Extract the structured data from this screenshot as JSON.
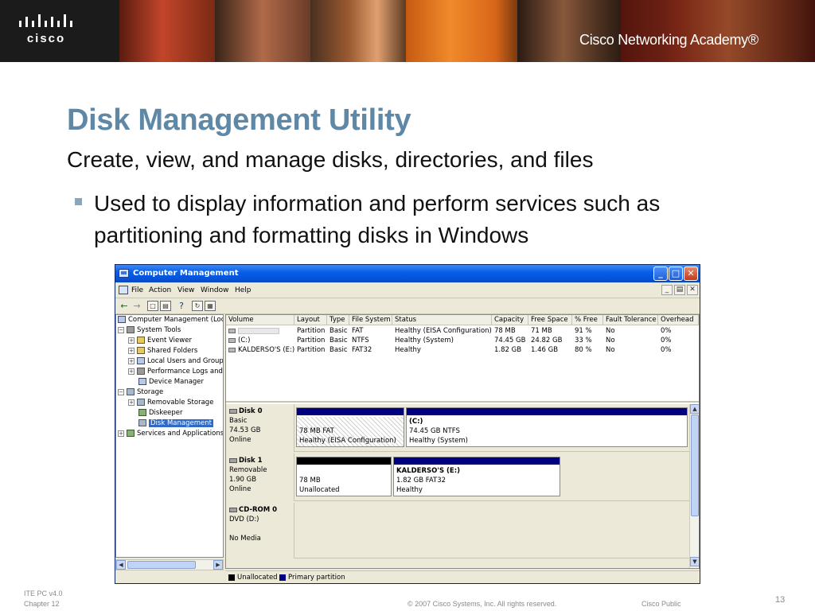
{
  "banner": {
    "logo_text": "cisco",
    "academy_text": "Cisco Networking Academy®"
  },
  "slide": {
    "title": "Disk Management Utility",
    "subtitle": "Create, view, and manage disks, directories, and files",
    "bullet": "Used to display information and perform services such as partitioning and formatting disks in Windows"
  },
  "window": {
    "title": "Computer Management",
    "menu": [
      "File",
      "Action",
      "View",
      "Window",
      "Help"
    ],
    "tree": {
      "items": [
        {
          "label": "Computer Management (Loc",
          "expander": "",
          "icon": "computer-icon"
        },
        {
          "label": "System Tools",
          "expander": "−",
          "icon": "tools-icon"
        },
        {
          "label": "Event Viewer",
          "expander": "+",
          "icon": "event-viewer-icon"
        },
        {
          "label": "Shared Folders",
          "expander": "+",
          "icon": "shared-folder-icon"
        },
        {
          "label": "Local Users and Group",
          "expander": "+",
          "icon": "users-icon"
        },
        {
          "label": "Performance Logs and",
          "expander": "+",
          "icon": "performance-icon"
        },
        {
          "label": "Device Manager",
          "expander": "",
          "icon": "device-manager-icon"
        },
        {
          "label": "Storage",
          "expander": "−",
          "icon": "storage-icon"
        },
        {
          "label": "Removable Storage",
          "expander": "+",
          "icon": "removable-storage-icon"
        },
        {
          "label": "Diskeeper",
          "expander": "",
          "icon": "diskeeper-icon"
        },
        {
          "label": "Disk Management",
          "expander": "",
          "icon": "disk-management-icon"
        },
        {
          "label": "Services and Applications",
          "expander": "+",
          "icon": "services-icon"
        }
      ]
    },
    "volumes": {
      "columns": [
        "Volume",
        "Layout",
        "Type",
        "File System",
        "Status",
        "Capacity",
        "Free Space",
        "% Free",
        "Fault Tolerance",
        "Overhead"
      ],
      "rows": [
        [
          "",
          "Partition",
          "Basic",
          "FAT",
          "Healthy (EISA Configuration)",
          "78 MB",
          "71 MB",
          "91 %",
          "No",
          "0%"
        ],
        [
          "(C:)",
          "Partition",
          "Basic",
          "NTFS",
          "Healthy (System)",
          "74.45 GB",
          "24.82 GB",
          "33 %",
          "No",
          "0%"
        ],
        [
          "KALDERSO'S (E:)",
          "Partition",
          "Basic",
          "FAT32",
          "Healthy",
          "1.82 GB",
          "1.46 GB",
          "80 %",
          "No",
          "0%"
        ]
      ]
    },
    "disks": [
      {
        "name": "Disk 0",
        "type": "Basic",
        "size": "74.53 GB",
        "state": "Online",
        "partitions": [
          {
            "name": "",
            "size": "78 MB FAT",
            "status": "Healthy (EISA Configuration)",
            "strip": "primary",
            "hatched": true
          },
          {
            "name": "(C:)",
            "size": "74.45 GB NTFS",
            "status": "Healthy (System)",
            "strip": "primary",
            "hatched": false
          }
        ]
      },
      {
        "name": "Disk 1",
        "type": "Removable",
        "size": "1.90 GB",
        "state": "Online",
        "partitions": [
          {
            "name": "",
            "size": "78 MB",
            "status": "Unallocated",
            "strip": "unallocated",
            "hatched": false
          },
          {
            "name": "KALDERSO'S  (E:)",
            "size": "1.82 GB FAT32",
            "status": "Healthy",
            "strip": "primary",
            "hatched": false
          }
        ]
      },
      {
        "name": "CD-ROM 0",
        "type": "DVD (D:)",
        "size": "",
        "state": "No Media",
        "partitions": []
      }
    ],
    "legend": [
      {
        "label": "Unallocated",
        "color": "#000000"
      },
      {
        "label": "Primary partition",
        "color": "#000080"
      }
    ]
  },
  "footer": {
    "course": "ITE PC v4.0",
    "chapter": "Chapter 12",
    "copyright": "© 2007 Cisco Systems, Inc. All rights reserved.",
    "classification": "Cisco Public",
    "page": "13"
  },
  "colors": {
    "title_blue": "#5f88a7",
    "titlebar_blue": "#0a5ee8",
    "primary_partition": "#000080",
    "unallocated": "#000000",
    "selection": "#316ac5"
  }
}
